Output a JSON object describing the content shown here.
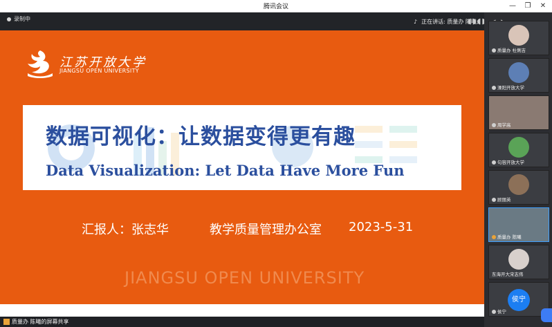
{
  "window": {
    "title": "腾讯会议"
  },
  "topbar": {
    "recording": "录制中",
    "speaking": "正在讲话: 质量办 陈曦;"
  },
  "slide": {
    "logo_cn": "江苏开放大学",
    "logo_en": "JIANGSU OPEN UNIVERSITY",
    "title_cn": "数据可视化：让数据变得更有趣",
    "title_en": "Data Visualization: Let Data Have More Fun",
    "reporter": "汇报人：张志华",
    "office": "教学质量管理办公室",
    "date": "2023-5-31",
    "watermark": "JIANGSU OPEN UNIVERSITY"
  },
  "bottombar": {
    "share_text": "质量办 陈曦的屏幕共享"
  },
  "participants": [
    {
      "name": "质量办 杜俐吉"
    },
    {
      "name": "溧阳开放大学"
    },
    {
      "name": "周学高"
    },
    {
      "name": "句容开放大学"
    },
    {
      "name": "顾丽英"
    },
    {
      "name": "质量办 陈曦"
    },
    {
      "name": "东海开大宋志伟"
    },
    {
      "name": "侯宁",
      "avatar_text": "侯宁"
    }
  ],
  "colors": {
    "slide_orange": "#e85b10",
    "title_blue": "#2b4f9e",
    "sidebar": "#2c2d31"
  }
}
